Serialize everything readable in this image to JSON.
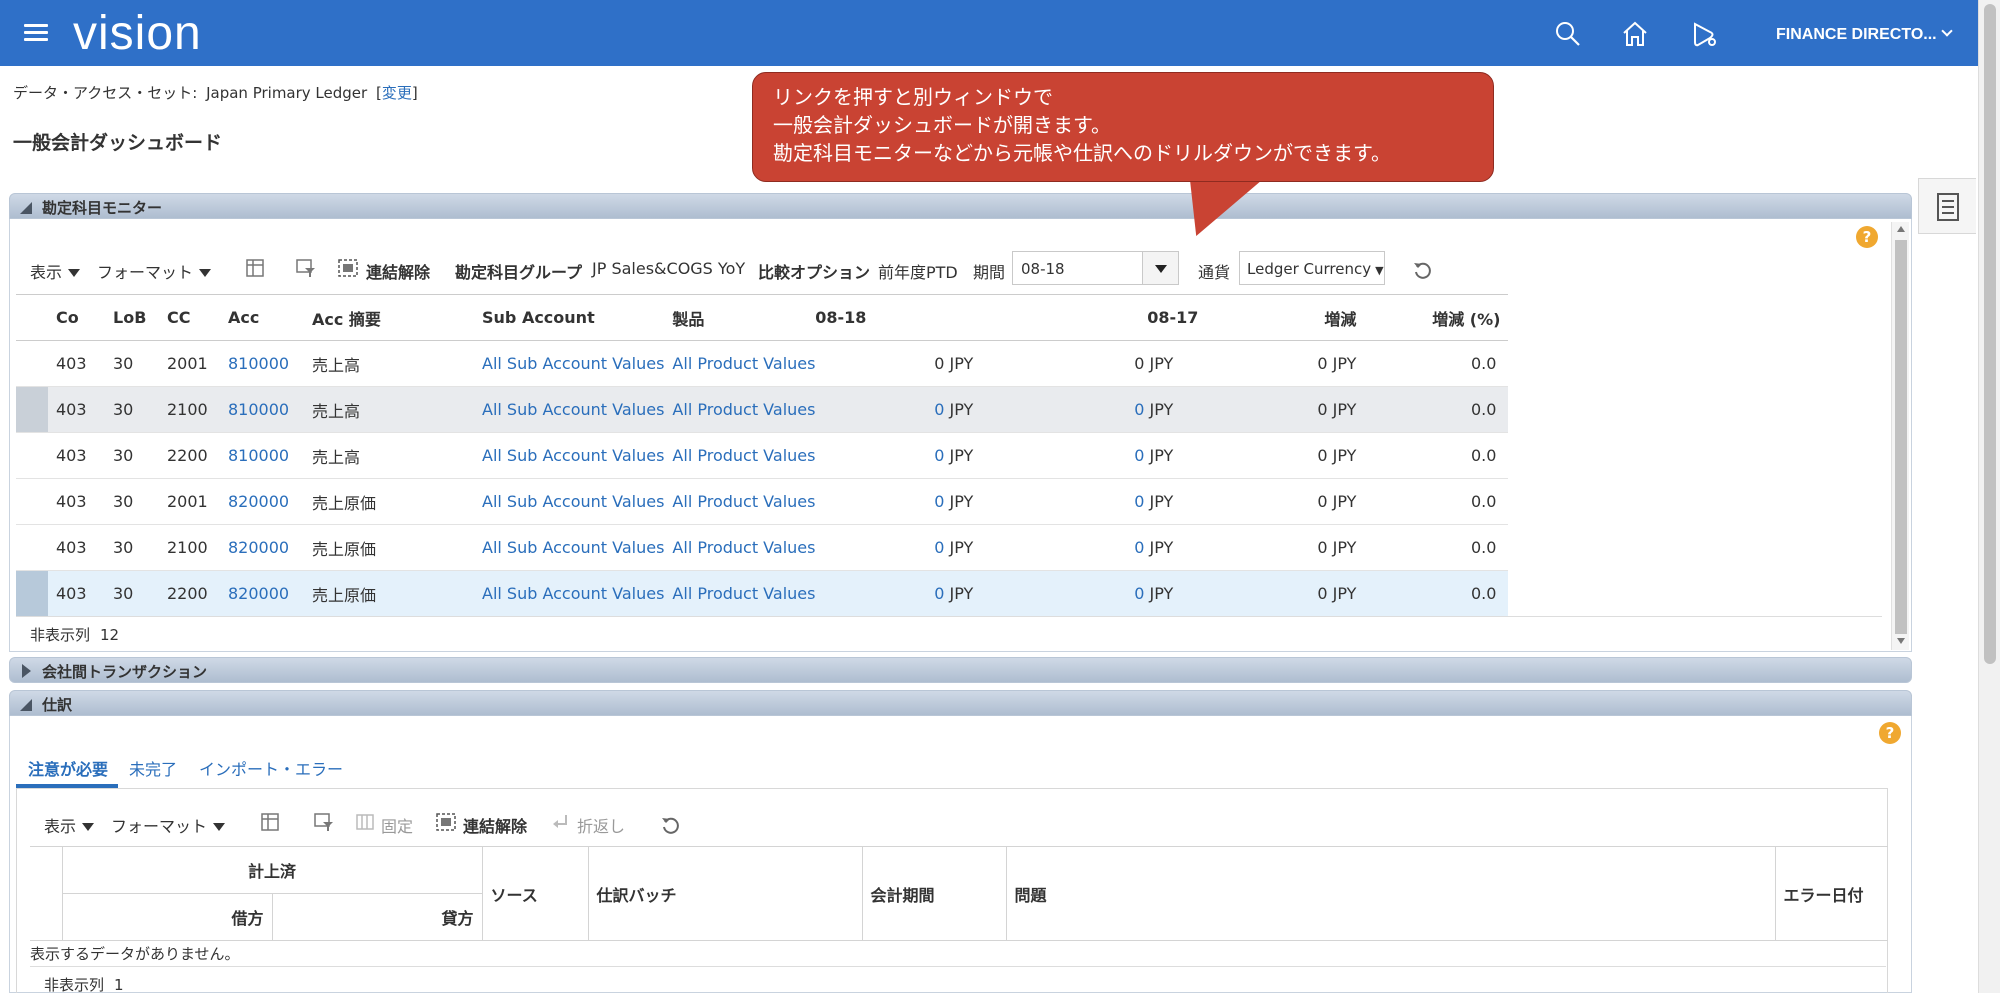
{
  "header": {
    "logo": "vision",
    "user_menu": "FINANCE DIRECTO..."
  },
  "context": {
    "dataset_label": "データ・アクセス・セット:",
    "dataset_value": "Japan Primary Ledger",
    "change_link": "変更",
    "page_title": "一般会計ダッシュボード"
  },
  "callout": {
    "line1": "リンクを押すと別ウィンドウで",
    "line2": "一般会計ダッシュボードが開きます。",
    "line3": "勘定科目モニターなどから元帳や仕訳へのドリルダウンができます。",
    "color": "#c94333"
  },
  "account_monitor": {
    "title": "勘定科目モニター",
    "toolbar": {
      "view": "表示",
      "format": "フォーマット",
      "detach": "連結解除",
      "group_label": "勘定科目グループ",
      "group_value": "JP Sales&COGS YoY",
      "compare_label": "比較オプション",
      "compare_value": "前年度PTD",
      "period_label": "期間",
      "period_value": "08-18",
      "currency_label": "通貨",
      "currency_value": "Ledger Currency"
    },
    "columns": [
      "Co",
      "LoB",
      "CC",
      "Acc",
      "Acc 摘要",
      "Sub Account",
      "製品",
      "08-18",
      "08-17",
      "増減",
      "増減 (%)"
    ],
    "rows": [
      {
        "co": "403",
        "lob": "30",
        "cc": "2001",
        "acc": "810000",
        "desc": "売上高",
        "sub": "All Sub Account Values",
        "product": "All Product Values",
        "cur_num": "0",
        "cur_unit": "JPY",
        "prev_num": "0",
        "prev_unit": "JPY",
        "diff": "0 JPY",
        "pct": "0.0",
        "num_link": false
      },
      {
        "co": "403",
        "lob": "30",
        "cc": "2100",
        "acc": "810000",
        "desc": "売上高",
        "sub": "All Sub Account Values",
        "product": "All Product Values",
        "cur_num": "0",
        "cur_unit": "JPY",
        "prev_num": "0",
        "prev_unit": "JPY",
        "diff": "0 JPY",
        "pct": "0.0",
        "num_link": true
      },
      {
        "co": "403",
        "lob": "30",
        "cc": "2200",
        "acc": "810000",
        "desc": "売上高",
        "sub": "All Sub Account Values",
        "product": "All Product Values",
        "cur_num": "0",
        "cur_unit": "JPY",
        "prev_num": "0",
        "prev_unit": "JPY",
        "diff": "0 JPY",
        "pct": "0.0",
        "num_link": true
      },
      {
        "co": "403",
        "lob": "30",
        "cc": "2001",
        "acc": "820000",
        "desc": "売上原価",
        "sub": "All Sub Account Values",
        "product": "All Product Values",
        "cur_num": "0",
        "cur_unit": "JPY",
        "prev_num": "0",
        "prev_unit": "JPY",
        "diff": "0 JPY",
        "pct": "0.0",
        "num_link": true
      },
      {
        "co": "403",
        "lob": "30",
        "cc": "2100",
        "acc": "820000",
        "desc": "売上原価",
        "sub": "All Sub Account Values",
        "product": "All Product Values",
        "cur_num": "0",
        "cur_unit": "JPY",
        "prev_num": "0",
        "prev_unit": "JPY",
        "diff": "0 JPY",
        "pct": "0.0",
        "num_link": true
      },
      {
        "co": "403",
        "lob": "30",
        "cc": "2200",
        "acc": "820000",
        "desc": "売上原価",
        "sub": "All Sub Account Values",
        "product": "All Product Values",
        "cur_num": "0",
        "cur_unit": "JPY",
        "prev_num": "0",
        "prev_unit": "JPY",
        "diff": "0 JPY",
        "pct": "0.0",
        "num_link": true
      }
    ],
    "hidden_cols_label": "非表示列",
    "hidden_cols_value": "12"
  },
  "intercompany": {
    "title": "会社間トランザクション"
  },
  "journals": {
    "title": "仕訳",
    "tabs": [
      "注意が必要",
      "未完了",
      "インポート・エラー"
    ],
    "toolbar": {
      "view": "表示",
      "format": "フォーマット",
      "freeze": "固定",
      "detach": "連結解除",
      "wrap": "折返し"
    },
    "group_header": "計上済",
    "col_debit": "借方",
    "col_credit": "貸方",
    "col_source": "ソース",
    "col_batch": "仕訳バッチ",
    "col_period": "会計期間",
    "col_issue": "問題",
    "col_error_date": "エラー日付",
    "no_data": "表示するデータがありません。",
    "hidden_cols_label": "非表示列",
    "hidden_cols_value": "1"
  }
}
